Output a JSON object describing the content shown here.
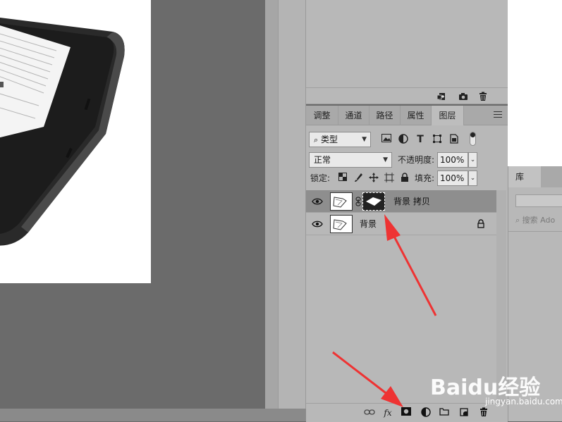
{
  "upper_toolbar": {
    "icons": [
      "new-snapshot-icon",
      "camera-icon",
      "trash-icon"
    ]
  },
  "tabs": [
    {
      "label": "调整",
      "active": false
    },
    {
      "label": "通道",
      "active": false
    },
    {
      "label": "路径",
      "active": false
    },
    {
      "label": "属性",
      "active": false
    },
    {
      "label": "图层",
      "active": true
    }
  ],
  "filter": {
    "kind_value": "类型",
    "icons": [
      "pixel-filter-icon",
      "adjustment-filter-icon",
      "type-filter-icon",
      "shape-filter-icon",
      "smart-object-filter-icon"
    ]
  },
  "blend": {
    "mode_value": "正常",
    "opacity_label": "不透明度:",
    "opacity_value": "100%"
  },
  "lock": {
    "label": "锁定:",
    "fill_label": "填充:",
    "fill_value": "100%"
  },
  "layers": [
    {
      "name": "背景 拷贝",
      "selected": true,
      "has_mask": true,
      "locked": false
    },
    {
      "name": "背景",
      "selected": false,
      "has_mask": false,
      "locked": true
    }
  ],
  "bottom_toolbar": {
    "fx_label": "fx",
    "icons": [
      "link-layers-icon",
      "fx-icon",
      "add-mask-icon",
      "adjustment-layer-icon",
      "new-group-icon",
      "new-layer-icon",
      "delete-layer-icon"
    ]
  },
  "library": {
    "tab_label": "库",
    "search_placeholder": "搜索 Ado"
  },
  "watermark": {
    "logo": "Baidu经验",
    "url": "jingyan.baidu.com"
  },
  "colors": {
    "arrow": "#ee3333",
    "panel": "#b8b8b8",
    "selected_row": "#8e8e8e"
  }
}
